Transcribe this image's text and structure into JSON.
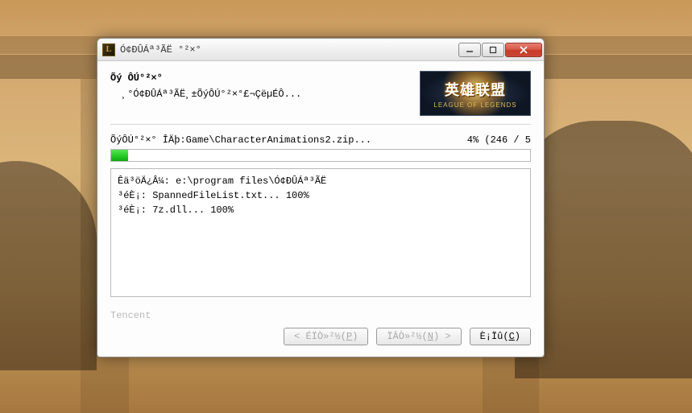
{
  "window": {
    "title": "Ó¢ÐÛÁª³ÃË °²×°",
    "app_icon_glyph": "L"
  },
  "header": {
    "title": "Õý ÔÚ°²×°",
    "subtitle": "¸°Ó¢ÐÛÁª³ÃË¸±ÕýÔÚ°²×°£¬ÇëµÉÔ..."
  },
  "logo": {
    "cn": "英雄联盟",
    "en": "LEAGUE OF LEGENDS"
  },
  "progress": {
    "status_prefix": "ÕýÔÚ°²×° ÎÄþ:",
    "status_path": "Game\\CharacterAnimations2.zip...",
    "percent_label": "4% (246 / 5",
    "percent_value": 4
  },
  "log_lines": [
    "Êä³öÄ¿Â¼: e:\\program files\\Ó¢ÐÛÁª³ÃË",
    "³éÈ¡: SpannedFileList.txt... 100%",
    "³éÈ¡: 7z.dll... 100%"
  ],
  "footer": {
    "brand": "Tencent"
  },
  "buttons": {
    "prev": "< ÉÏÒ»²½(P)",
    "prev_accel": "P",
    "next": "ÏÂÒ»²½(N) >",
    "next_accel": "N",
    "cancel": "È¡Ïû(C)",
    "cancel_accel": "C"
  }
}
